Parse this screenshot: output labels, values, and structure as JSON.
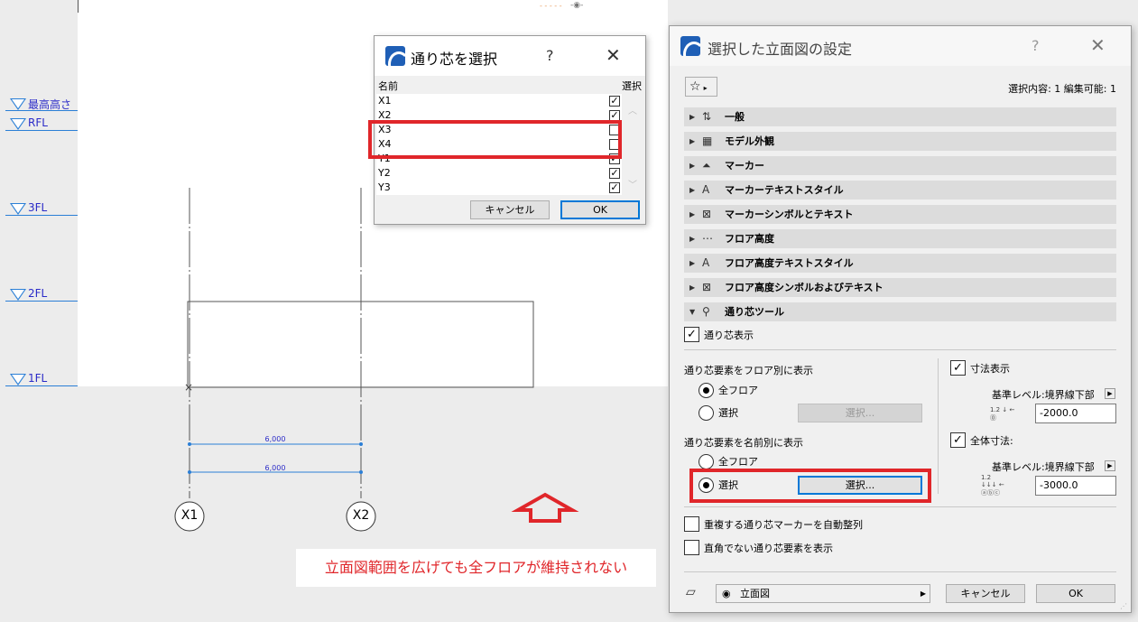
{
  "levels": [
    {
      "name": "最高高さ"
    },
    {
      "name": "RFL"
    },
    {
      "name": "3FL"
    },
    {
      "name": "2FL"
    },
    {
      "name": "1FL"
    }
  ],
  "grid_axes": {
    "x1": "X1",
    "x2": "X2"
  },
  "dimensions": {
    "d1": "6,000",
    "d2": "6,000"
  },
  "note": "立面図範囲を広げても全フロアが維持されない",
  "grid_dialog": {
    "title": "通り芯を選択",
    "help": "?",
    "col_name": "名前",
    "col_select": "選択",
    "rows": [
      {
        "name": "X1",
        "checked": true
      },
      {
        "name": "X2",
        "checked": true
      },
      {
        "name": "X3",
        "checked": false
      },
      {
        "name": "X4",
        "checked": false
      },
      {
        "name": "Y1",
        "checked": true
      },
      {
        "name": "Y2",
        "checked": true
      },
      {
        "name": "Y3",
        "checked": true
      }
    ],
    "cancel": "キャンセル",
    "ok": "OK"
  },
  "settings": {
    "title": "選択した立面図の設定",
    "help": "?",
    "selection_info": "選択内容: 1 編集可能: 1",
    "sections": [
      {
        "label": "一般",
        "icon": "general-icon"
      },
      {
        "label": "モデル外観",
        "icon": "model-display-icon"
      },
      {
        "label": "マーカー",
        "icon": "marker-icon"
      },
      {
        "label": "マーカーテキストスタイル",
        "icon": "marker-text-icon"
      },
      {
        "label": "マーカーシンボルとテキスト",
        "icon": "marker-symbol-icon"
      },
      {
        "label": "フロア高度",
        "icon": "story-levels-icon"
      },
      {
        "label": "フロア高度テキストスタイル",
        "icon": "story-text-icon"
      },
      {
        "label": "フロア高度シンボルおよびテキスト",
        "icon": "story-symbol-icon"
      },
      {
        "label": "通り芯ツール",
        "icon": "grid-tool-icon"
      }
    ],
    "show_grid": "通り芯表示",
    "by_floor_label": "通り芯要素をフロア別に表示",
    "all_floors": "全フロア",
    "select": "選択",
    "select_btn": "選択...",
    "by_name_label": "通り芯要素を名前別に表示",
    "show_dim": "寸法表示",
    "ref_level_1": "基準レベル:境界線下部",
    "dim_value_1": "-2000.0",
    "overall_dim": "全体寸法:",
    "ref_level_2": "基準レベル:境界線下部",
    "dim_value_2": "-3000.0",
    "auto_arrange": "重複する通り芯マーカーを自動整列",
    "non_orthogonal": "直角でない通り芯要素を表示",
    "view_name": "立面図",
    "cancel": "キャンセル",
    "ok": "OK"
  },
  "colors": {
    "accent": "#0078d7",
    "highlight": "#e0262a",
    "level": "#2b7fd6"
  }
}
